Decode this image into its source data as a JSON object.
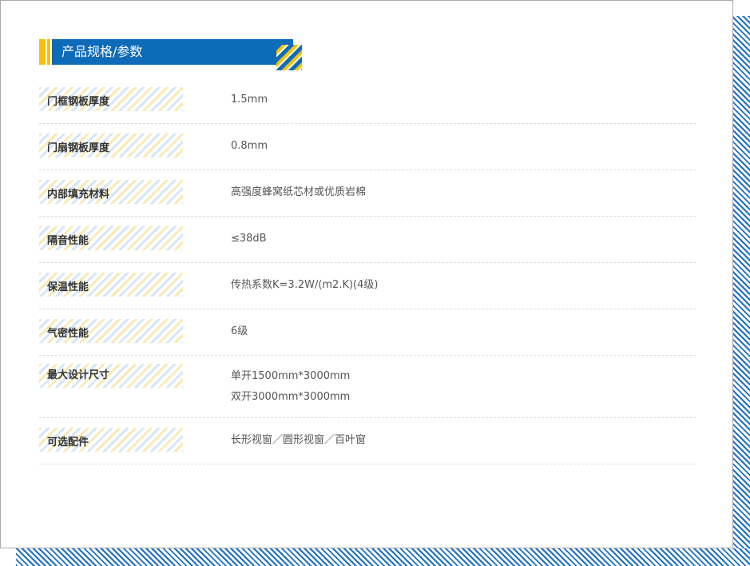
{
  "section": {
    "title": "产品规格/参数",
    "accent_colors": {
      "blue": "#0e6bb8",
      "yellow": "#f5c200"
    }
  },
  "specs": [
    {
      "label": "门框钢板厚度",
      "values": [
        "1.5mm"
      ]
    },
    {
      "label": "门扇钢板厚度",
      "values": [
        "0.8mm"
      ]
    },
    {
      "label": "内部填充材料",
      "values": [
        "高强度蜂窝纸芯材或优质岩棉"
      ]
    },
    {
      "label": "隔音性能",
      "values": [
        "≤38dB"
      ]
    },
    {
      "label": "保温性能",
      "values": [
        "传热系数K=3.2W/(m2.K)(4级)"
      ]
    },
    {
      "label": "气密性能",
      "values": [
        "6级"
      ]
    },
    {
      "label": "最大设计尺寸",
      "values": [
        "单开1500mm*3000mm",
        "双开3000mm*3000mm"
      ]
    },
    {
      "label": "可选配件",
      "values": [
        "长形视窗／圆形视窗／百叶窗"
      ]
    }
  ]
}
